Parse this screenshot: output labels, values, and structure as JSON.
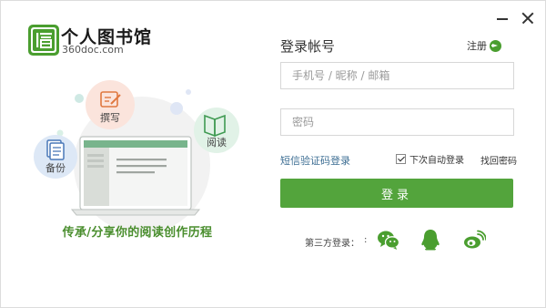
{
  "brand": {
    "title": "个人图书馆",
    "subtitle": "360doc.com",
    "color": "#4a9e2f"
  },
  "illustration": {
    "features": {
      "write": "撰写",
      "backup": "备份",
      "read": "阅读"
    },
    "slogan": "传承/分享你的阅读创作历程"
  },
  "login": {
    "title": "登录帐号",
    "register_label": "注册",
    "username_placeholder": "手机号 / 昵称 / 邮箱",
    "password_placeholder": "密码",
    "sms_login_label": "短信验证码登录",
    "auto_login_label": "下次自动登录",
    "auto_login_checked": true,
    "forgot_label": "找回密码",
    "submit_label": "登录",
    "button_color": "#53a43c"
  },
  "third_party": {
    "label": "第三方登录：",
    "separator": ":",
    "providers": [
      "wechat-icon",
      "qq-icon",
      "weibo-icon"
    ]
  }
}
